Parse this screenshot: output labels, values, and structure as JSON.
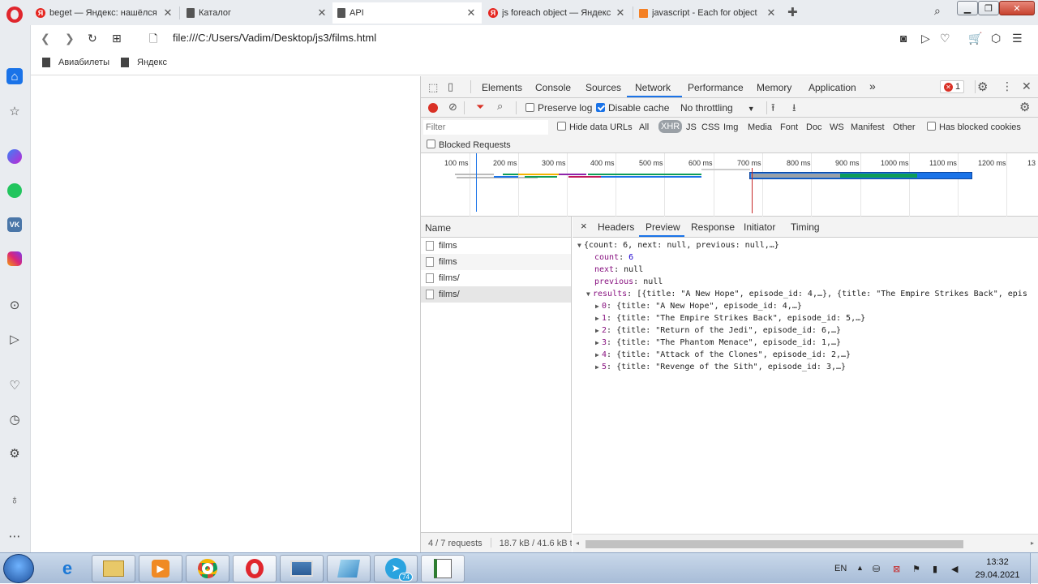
{
  "browser": {
    "tabs": [
      {
        "title": "beget — Яндекс: нашёлся",
        "favicon": "yandex-icon"
      },
      {
        "title": "Каталог",
        "favicon": "document-icon"
      },
      {
        "title": "API",
        "favicon": "document-icon",
        "active": true
      },
      {
        "title": "js foreach object — Яндекс",
        "favicon": "yandex-icon"
      },
      {
        "title": "javascript - Each for object",
        "favicon": "stackoverflow-icon"
      }
    ],
    "url": "file:///C:/Users/Vadim/Desktop/js3/films.html",
    "bookmarks": [
      "Авиабилеты",
      "Яндекс"
    ],
    "yandex_letter": "Я"
  },
  "devtools": {
    "main_tabs": [
      "Elements",
      "Console",
      "Sources",
      "Network",
      "Performance",
      "Memory",
      "Application"
    ],
    "more": "»",
    "error_count": "1",
    "toolbar": {
      "preserve_log": "Preserve log",
      "disable_cache": "Disable cache",
      "throttling": "No throttling"
    },
    "filter": {
      "placeholder": "Filter",
      "hide_data_urls": "Hide data URLs",
      "types": [
        "All",
        "XHR",
        "JS",
        "CSS",
        "Img",
        "Media",
        "Font",
        "Doc",
        "WS",
        "Manifest",
        "Other"
      ],
      "selected_type": "XHR",
      "has_blocked_cookies": "Has blocked cookies",
      "blocked_requests": "Blocked Requests"
    },
    "timeline_ticks": [
      "100 ms",
      "200 ms",
      "300 ms",
      "400 ms",
      "500 ms",
      "600 ms",
      "700 ms",
      "800 ms",
      "900 ms",
      "1000 ms",
      "1100 ms",
      "1200 ms",
      "13"
    ],
    "names_header": "Name",
    "requests": [
      "films",
      "films",
      "films/",
      "films/"
    ],
    "footer": {
      "requests": "4 / 7 requests",
      "size": "18.7 kB / 41.6 kB t"
    },
    "detail_tabs": [
      "Headers",
      "Preview",
      "Response",
      "Initiator",
      "Timing"
    ],
    "detail_close": "×",
    "preview": {
      "root": "{count: 6, next: null, previous: null,…}",
      "count_key": "count",
      "count_val": "6",
      "next_key": "next",
      "next_val": "null",
      "previous_key": "previous",
      "previous_val": "null",
      "results_key": "results",
      "results_summary": "[{title: \"A New Hope\", episode_id: 4,…}, {title: \"The Empire Strikes Back\", epis",
      "items": [
        {
          "key": "0",
          "val": "{title: \"A New Hope\", episode_id: 4,…}"
        },
        {
          "key": "1",
          "val": "{title: \"The Empire Strikes Back\", episode_id: 5,…}"
        },
        {
          "key": "2",
          "val": "{title: \"Return of the Jedi\", episode_id: 6,…}"
        },
        {
          "key": "3",
          "val": "{title: \"The Phantom Menace\", episode_id: 1,…}"
        },
        {
          "key": "4",
          "val": "{title: \"Attack of the Clones\", episode_id: 2,…}"
        },
        {
          "key": "5",
          "val": "{title: \"Revenge of the Sith\", episode_id: 3,…}"
        }
      ]
    }
  },
  "taskbar": {
    "lang": "EN",
    "time": "13:32",
    "date": "29.04.2021",
    "telegram_badge": "74"
  }
}
